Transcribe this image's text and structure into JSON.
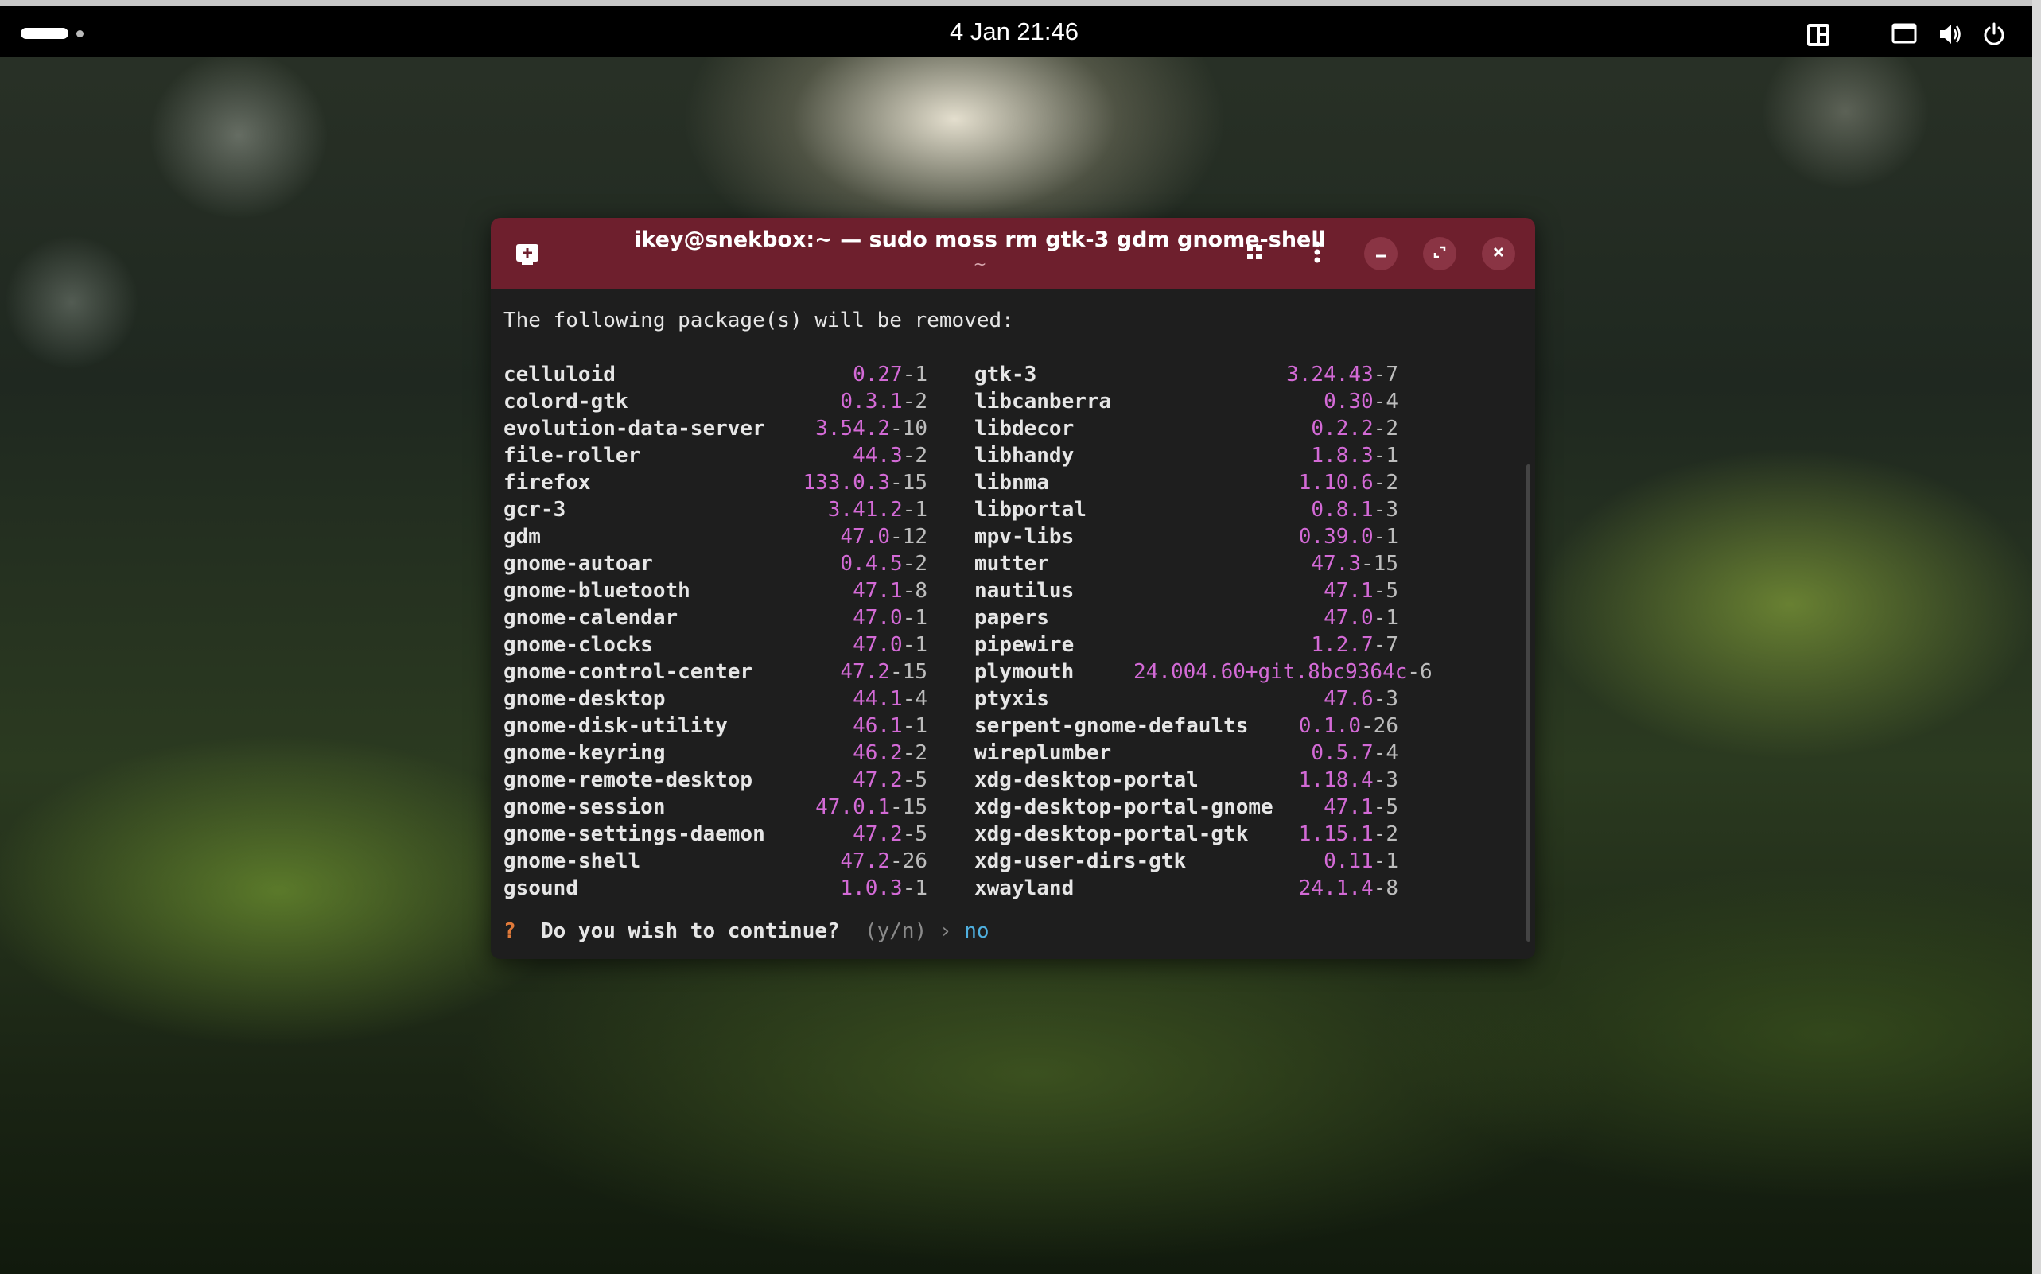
{
  "topbar": {
    "clock": "4 Jan  21:46",
    "icons": [
      "activities-pill",
      "window-tiling-icon",
      "display-icon",
      "volume-icon",
      "power-icon"
    ]
  },
  "terminal": {
    "title": "ikey@snekbox:~ — sudo moss rm gtk-3 gdm gnome-shell",
    "subtitle": "~",
    "intro": "The following package(s) will be removed:",
    "left_packages": [
      {
        "name": "celluloid",
        "num": "0.27",
        "rel": "-1"
      },
      {
        "name": "colord-gtk",
        "num": "0.3.1",
        "rel": "-2"
      },
      {
        "name": "evolution-data-server",
        "num": "3.54.2",
        "rel": "-10"
      },
      {
        "name": "file-roller",
        "num": "44.3",
        "rel": "-2"
      },
      {
        "name": "firefox",
        "num": "133.0.3",
        "rel": "-15"
      },
      {
        "name": "gcr-3",
        "num": "3.41.2",
        "rel": "-1"
      },
      {
        "name": "gdm",
        "num": "47.0",
        "rel": "-12"
      },
      {
        "name": "gnome-autoar",
        "num": "0.4.5",
        "rel": "-2"
      },
      {
        "name": "gnome-bluetooth",
        "num": "47.1",
        "rel": "-8"
      },
      {
        "name": "gnome-calendar",
        "num": "47.0",
        "rel": "-1"
      },
      {
        "name": "gnome-clocks",
        "num": "47.0",
        "rel": "-1"
      },
      {
        "name": "gnome-control-center",
        "num": "47.2",
        "rel": "-15"
      },
      {
        "name": "gnome-desktop",
        "num": "44.1",
        "rel": "-4"
      },
      {
        "name": "gnome-disk-utility",
        "num": "46.1",
        "rel": "-1"
      },
      {
        "name": "gnome-keyring",
        "num": "46.2",
        "rel": "-2"
      },
      {
        "name": "gnome-remote-desktop",
        "num": "47.2",
        "rel": "-5"
      },
      {
        "name": "gnome-session",
        "num": "47.0.1",
        "rel": "-15"
      },
      {
        "name": "gnome-settings-daemon",
        "num": "47.2",
        "rel": "-5"
      },
      {
        "name": "gnome-shell",
        "num": "47.2",
        "rel": "-26"
      },
      {
        "name": "gsound",
        "num": "1.0.3",
        "rel": "-1"
      }
    ],
    "right_packages": [
      {
        "name": "gtk-3",
        "num": "3.24.43",
        "rel": "-7"
      },
      {
        "name": "libcanberra",
        "num": "0.30",
        "rel": "-4"
      },
      {
        "name": "libdecor",
        "num": "0.2.2",
        "rel": "-2"
      },
      {
        "name": "libhandy",
        "num": "1.8.3",
        "rel": "-1"
      },
      {
        "name": "libnma",
        "num": "1.10.6",
        "rel": "-2"
      },
      {
        "name": "libportal",
        "num": "0.8.1",
        "rel": "-3"
      },
      {
        "name": "mpv-libs",
        "num": "0.39.0",
        "rel": "-1"
      },
      {
        "name": "mutter",
        "num": "47.3",
        "rel": "-15"
      },
      {
        "name": "nautilus",
        "num": "47.1",
        "rel": "-5"
      },
      {
        "name": "papers",
        "num": "47.0",
        "rel": "-1"
      },
      {
        "name": "pipewire",
        "num": "1.2.7",
        "rel": "-7"
      },
      {
        "name": "plymouth",
        "num": "24.004.60+git.8bc9364c",
        "rel": "-6"
      },
      {
        "name": "ptyxis",
        "num": "47.6",
        "rel": "-3"
      },
      {
        "name": "serpent-gnome-defaults",
        "num": "0.1.0",
        "rel": "-26"
      },
      {
        "name": "wireplumber",
        "num": "0.5.7",
        "rel": "-4"
      },
      {
        "name": "xdg-desktop-portal",
        "num": "1.18.4",
        "rel": "-3"
      },
      {
        "name": "xdg-desktop-portal-gnome",
        "num": "47.1",
        "rel": "-5"
      },
      {
        "name": "xdg-desktop-portal-gtk",
        "num": "1.15.1",
        "rel": "-2"
      },
      {
        "name": "xdg-user-dirs-gtk",
        "num": "0.11",
        "rel": "-1"
      },
      {
        "name": "xwayland",
        "num": "24.1.4",
        "rel": "-8"
      }
    ],
    "prompt": {
      "marker": "?",
      "question": "Do you wish to continue?",
      "hint": "(y/n) ›",
      "answer": "no"
    }
  },
  "colors": {
    "headerbar": "#6e1f2d",
    "terminal_bg": "#1e1e1e",
    "version": "#d36ad6"
  }
}
